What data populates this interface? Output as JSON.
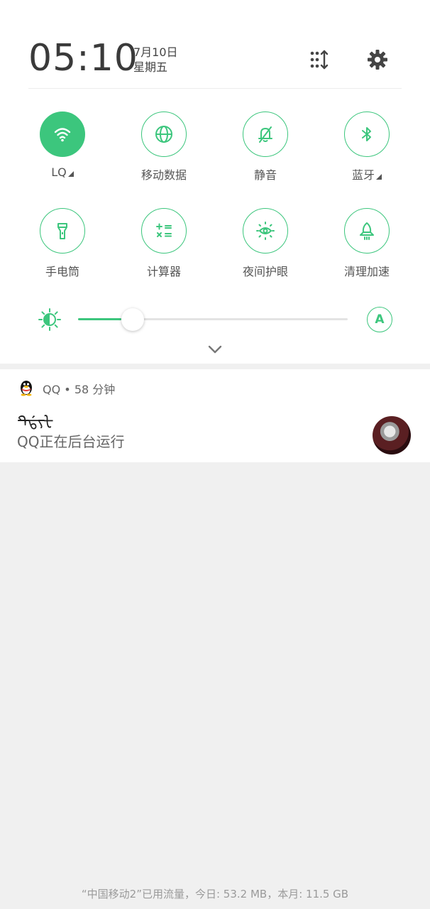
{
  "header": {
    "time": "05:10",
    "date": "7月10日",
    "weekday": "星期五",
    "edit_icon": "grid-sort-icon",
    "settings_icon": "gear-icon"
  },
  "tiles": [
    {
      "label": "LQ",
      "icon": "wifi-icon",
      "active": true,
      "has_menu": true
    },
    {
      "label": "移动数据",
      "icon": "globe-icon",
      "active": false,
      "has_menu": false
    },
    {
      "label": "静音",
      "icon": "bell-off-icon",
      "active": false,
      "has_menu": false
    },
    {
      "label": "蓝牙",
      "icon": "bluetooth-icon",
      "active": false,
      "has_menu": true
    },
    {
      "label": "手电筒",
      "icon": "flashlight-icon",
      "active": false,
      "has_menu": false
    },
    {
      "label": "计算器",
      "icon": "calculator-icon",
      "active": false,
      "has_menu": false
    },
    {
      "label": "夜间护眼",
      "icon": "eye-sun-icon",
      "active": false,
      "has_menu": false
    },
    {
      "label": "清理加速",
      "icon": "rocket-icon",
      "active": false,
      "has_menu": false
    }
  ],
  "brightness": {
    "level": 0.16,
    "auto_label": "A"
  },
  "notification": {
    "app": "QQ",
    "separator": "•",
    "age": "58 分钟",
    "title": "ᡨᡩᡪᡫ",
    "text": "QQ正在后台运行"
  },
  "footer": {
    "data_usage": "“中国移动2”已用流量，今日: 53.2 MB，本月: 11.5 GB"
  },
  "colors": {
    "accent": "#3cc67d",
    "background": "#f0f0f0"
  }
}
